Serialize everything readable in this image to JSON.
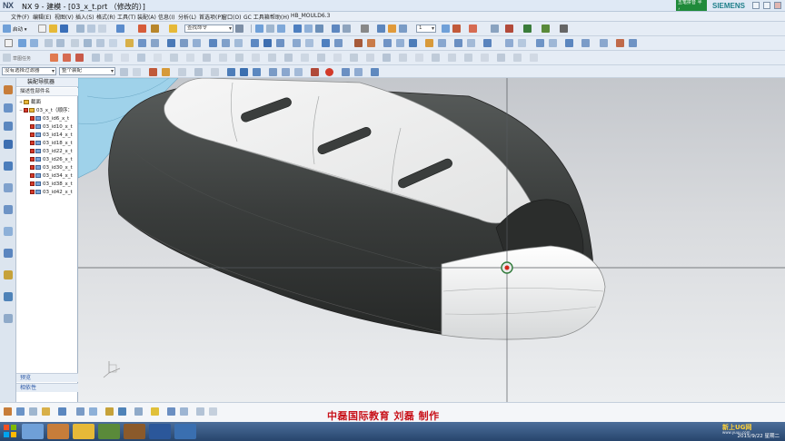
{
  "window": {
    "app_logo": "NX",
    "title": "NX 9 - 建模 - [03_x_t.prt （修改的）]",
    "badge_text": "五笔拼音 半 ，",
    "brand": "SIEMENS"
  },
  "menu": {
    "items": [
      "文件(F)",
      "编辑(E)",
      "视图(V)",
      "插入(S)",
      "格式(R)",
      "工具(T)",
      "装配(A)",
      "信息(I)",
      "分析(L)",
      "首选项(P)",
      "窗口(O)",
      "GC 工具箱",
      "帮助(H)",
      "HB_MOULD6.3"
    ]
  },
  "toolbar1": {
    "start_label": "启动 ▾",
    "command_finder_placeholder": "查找命令",
    "counter_value": "1"
  },
  "toolbar2": {
    "left_label": "草图任务",
    "filter_value": "没有选择过滤器",
    "scope_value": "整个装配"
  },
  "navigator": {
    "title": "装配导航器",
    "column_header": "描述性部件名",
    "rows": [
      {
        "label": "截面",
        "level": 1,
        "type": "folder",
        "twisty": "+"
      },
      {
        "label": "03_x_t（顺序：",
        "level": 1,
        "type": "assembly",
        "twisty": "−"
      },
      {
        "label": "03_id6_x_t",
        "level": 2,
        "type": "part"
      },
      {
        "label": "03_id10_x_t",
        "level": 2,
        "type": "part"
      },
      {
        "label": "03_id14_x_t",
        "level": 2,
        "type": "part"
      },
      {
        "label": "03_id18_x_t",
        "level": 2,
        "type": "part"
      },
      {
        "label": "03_id22_x_t",
        "level": 2,
        "type": "part"
      },
      {
        "label": "03_id26_x_t",
        "level": 2,
        "type": "part"
      },
      {
        "label": "03_id30_x_t",
        "level": 2,
        "type": "part"
      },
      {
        "label": "03_id34_x_t",
        "level": 2,
        "type": "part"
      },
      {
        "label": "03_id38_x_t",
        "level": 2,
        "type": "part"
      },
      {
        "label": "03_id42_x_t",
        "level": 2,
        "type": "part"
      }
    ],
    "footer_preview": "预览",
    "footer_dependency": "相依性"
  },
  "bottom": {
    "credit_text": "中磊国际教育  刘磊  制作"
  },
  "taskbar": {
    "clock_line1": "",
    "clock_line2": "2015/9/22 星期二",
    "site_logo": "新上UG网",
    "site_url": "www.yuuu.com"
  },
  "colors": {
    "body_dark": "#3d4140",
    "body_light": "#f3f3f3",
    "accent_red": "#c8121a",
    "ui_bg": "#e5ecf5"
  }
}
